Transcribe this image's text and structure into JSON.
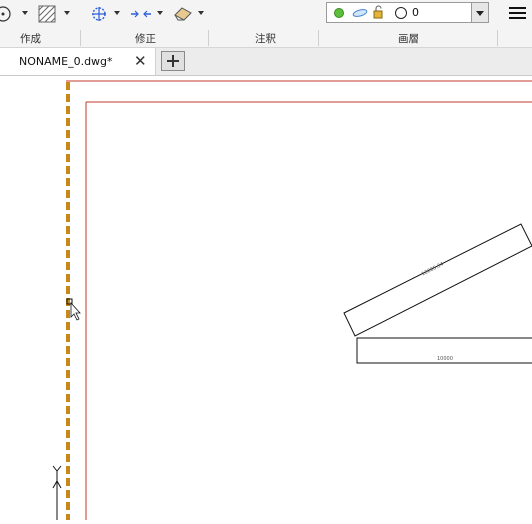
{
  "ribbon": {
    "panels": [
      {
        "label": "作成"
      },
      {
        "label": "修正"
      },
      {
        "label": "注釈"
      },
      {
        "label": "画層"
      }
    ],
    "layer_value": "0"
  },
  "tabs": [
    {
      "label": "NONAME_0.dwg*"
    }
  ],
  "drawing": {
    "dimension_upper": "12205.34",
    "dimension_lower": "10000"
  },
  "colors": {
    "frame_red": "#c0392b",
    "axis_orange": "#c8891c"
  }
}
